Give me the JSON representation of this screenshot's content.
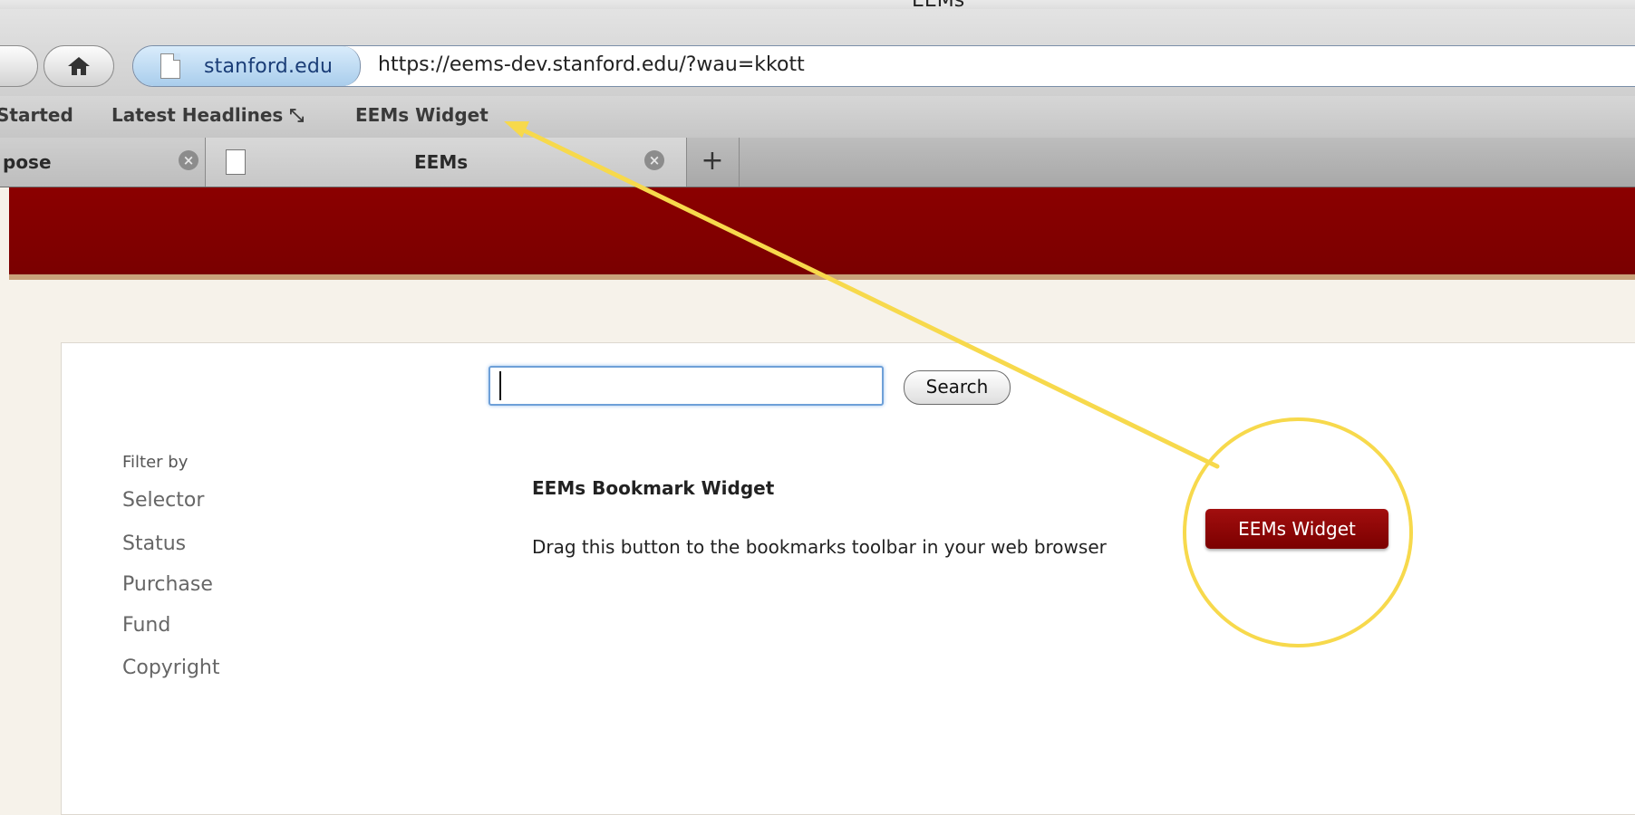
{
  "window": {
    "title": "EEMs"
  },
  "toolbar": {
    "site_identity": "stanford.edu",
    "url": "https://eems-dev.stanford.edu/?wau=kkott"
  },
  "bookmarks": [
    {
      "label": "Started"
    },
    {
      "label": "Latest Headlines ⤡"
    },
    {
      "label": "EEMs Widget"
    }
  ],
  "tabs": [
    {
      "label": "pose"
    },
    {
      "label": "EEMs"
    }
  ],
  "new_tab_label": "+",
  "search": {
    "value": "",
    "button_label": "Search"
  },
  "filter": {
    "title": "Filter by",
    "items": [
      "Selector",
      "Status",
      "Purchase",
      "Fund",
      "Copyright"
    ]
  },
  "widget": {
    "title": "EEMs Bookmark Widget",
    "description": "Drag this button to the bookmarks toolbar in your web browser",
    "button_label": "EEMs Widget"
  },
  "colors": {
    "header_red": "#8b0000",
    "annotation_yellow": "#f7d94c"
  }
}
